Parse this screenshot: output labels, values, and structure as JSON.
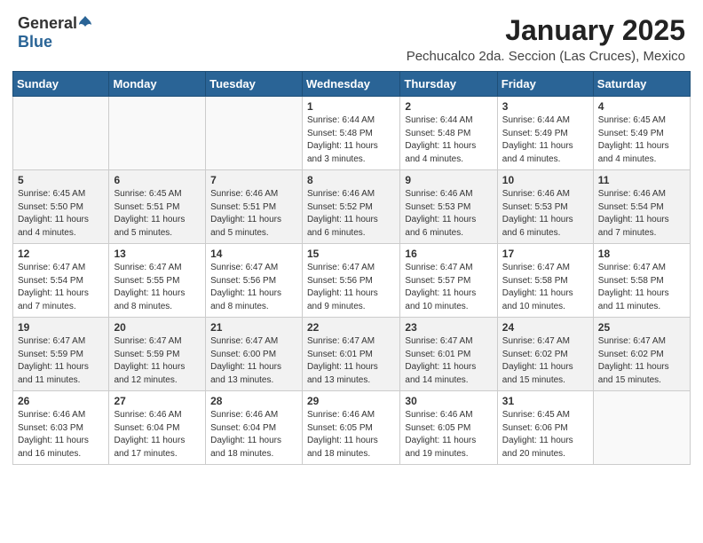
{
  "header": {
    "logo": {
      "general": "General",
      "blue": "Blue"
    },
    "title": "January 2025",
    "subtitle": "Pechucalco 2da. Seccion (Las Cruces), Mexico"
  },
  "calendar": {
    "weekdays": [
      "Sunday",
      "Monday",
      "Tuesday",
      "Wednesday",
      "Thursday",
      "Friday",
      "Saturday"
    ],
    "weeks": [
      [
        {
          "day": "",
          "content": ""
        },
        {
          "day": "",
          "content": ""
        },
        {
          "day": "",
          "content": ""
        },
        {
          "day": "1",
          "content": "Sunrise: 6:44 AM\nSunset: 5:48 PM\nDaylight: 11 hours\nand 3 minutes."
        },
        {
          "day": "2",
          "content": "Sunrise: 6:44 AM\nSunset: 5:48 PM\nDaylight: 11 hours\nand 4 minutes."
        },
        {
          "day": "3",
          "content": "Sunrise: 6:44 AM\nSunset: 5:49 PM\nDaylight: 11 hours\nand 4 minutes."
        },
        {
          "day": "4",
          "content": "Sunrise: 6:45 AM\nSunset: 5:49 PM\nDaylight: 11 hours\nand 4 minutes."
        }
      ],
      [
        {
          "day": "5",
          "content": "Sunrise: 6:45 AM\nSunset: 5:50 PM\nDaylight: 11 hours\nand 4 minutes."
        },
        {
          "day": "6",
          "content": "Sunrise: 6:45 AM\nSunset: 5:51 PM\nDaylight: 11 hours\nand 5 minutes."
        },
        {
          "day": "7",
          "content": "Sunrise: 6:46 AM\nSunset: 5:51 PM\nDaylight: 11 hours\nand 5 minutes."
        },
        {
          "day": "8",
          "content": "Sunrise: 6:46 AM\nSunset: 5:52 PM\nDaylight: 11 hours\nand 6 minutes."
        },
        {
          "day": "9",
          "content": "Sunrise: 6:46 AM\nSunset: 5:53 PM\nDaylight: 11 hours\nand 6 minutes."
        },
        {
          "day": "10",
          "content": "Sunrise: 6:46 AM\nSunset: 5:53 PM\nDaylight: 11 hours\nand 6 minutes."
        },
        {
          "day": "11",
          "content": "Sunrise: 6:46 AM\nSunset: 5:54 PM\nDaylight: 11 hours\nand 7 minutes."
        }
      ],
      [
        {
          "day": "12",
          "content": "Sunrise: 6:47 AM\nSunset: 5:54 PM\nDaylight: 11 hours\nand 7 minutes."
        },
        {
          "day": "13",
          "content": "Sunrise: 6:47 AM\nSunset: 5:55 PM\nDaylight: 11 hours\nand 8 minutes."
        },
        {
          "day": "14",
          "content": "Sunrise: 6:47 AM\nSunset: 5:56 PM\nDaylight: 11 hours\nand 8 minutes."
        },
        {
          "day": "15",
          "content": "Sunrise: 6:47 AM\nSunset: 5:56 PM\nDaylight: 11 hours\nand 9 minutes."
        },
        {
          "day": "16",
          "content": "Sunrise: 6:47 AM\nSunset: 5:57 PM\nDaylight: 11 hours\nand 10 minutes."
        },
        {
          "day": "17",
          "content": "Sunrise: 6:47 AM\nSunset: 5:58 PM\nDaylight: 11 hours\nand 10 minutes."
        },
        {
          "day": "18",
          "content": "Sunrise: 6:47 AM\nSunset: 5:58 PM\nDaylight: 11 hours\nand 11 minutes."
        }
      ],
      [
        {
          "day": "19",
          "content": "Sunrise: 6:47 AM\nSunset: 5:59 PM\nDaylight: 11 hours\nand 11 minutes."
        },
        {
          "day": "20",
          "content": "Sunrise: 6:47 AM\nSunset: 5:59 PM\nDaylight: 11 hours\nand 12 minutes."
        },
        {
          "day": "21",
          "content": "Sunrise: 6:47 AM\nSunset: 6:00 PM\nDaylight: 11 hours\nand 13 minutes."
        },
        {
          "day": "22",
          "content": "Sunrise: 6:47 AM\nSunset: 6:01 PM\nDaylight: 11 hours\nand 13 minutes."
        },
        {
          "day": "23",
          "content": "Sunrise: 6:47 AM\nSunset: 6:01 PM\nDaylight: 11 hours\nand 14 minutes."
        },
        {
          "day": "24",
          "content": "Sunrise: 6:47 AM\nSunset: 6:02 PM\nDaylight: 11 hours\nand 15 minutes."
        },
        {
          "day": "25",
          "content": "Sunrise: 6:47 AM\nSunset: 6:02 PM\nDaylight: 11 hours\nand 15 minutes."
        }
      ],
      [
        {
          "day": "26",
          "content": "Sunrise: 6:46 AM\nSunset: 6:03 PM\nDaylight: 11 hours\nand 16 minutes."
        },
        {
          "day": "27",
          "content": "Sunrise: 6:46 AM\nSunset: 6:04 PM\nDaylight: 11 hours\nand 17 minutes."
        },
        {
          "day": "28",
          "content": "Sunrise: 6:46 AM\nSunset: 6:04 PM\nDaylight: 11 hours\nand 18 minutes."
        },
        {
          "day": "29",
          "content": "Sunrise: 6:46 AM\nSunset: 6:05 PM\nDaylight: 11 hours\nand 18 minutes."
        },
        {
          "day": "30",
          "content": "Sunrise: 6:46 AM\nSunset: 6:05 PM\nDaylight: 11 hours\nand 19 minutes."
        },
        {
          "day": "31",
          "content": "Sunrise: 6:45 AM\nSunset: 6:06 PM\nDaylight: 11 hours\nand 20 minutes."
        },
        {
          "day": "",
          "content": ""
        }
      ]
    ]
  }
}
